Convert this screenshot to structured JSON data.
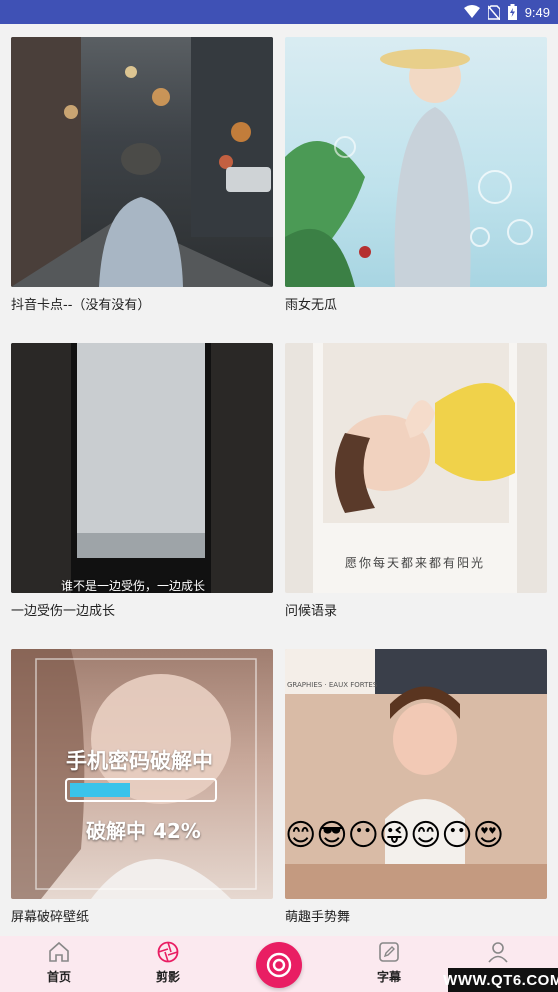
{
  "status_bar": {
    "time": "9:49"
  },
  "cards": [
    {
      "title": "抖音卡点--（没有没有）"
    },
    {
      "title": "雨女无瓜"
    },
    {
      "title": "一边受伤一边成长",
      "overlay": "谁不是一边受伤，一边成长"
    },
    {
      "title": "问候语录",
      "overlay": "愿你每天都来都有阳光"
    },
    {
      "title": "屏幕破碎壁纸",
      "overlay_top": "手机密码破解中",
      "overlay_bottom": "破解中 42%",
      "progress": 0.42
    },
    {
      "title": "萌趣手势舞",
      "overlay": "GRAPHIES · EAUX FORTES"
    }
  ],
  "nav": {
    "home": "首页",
    "clip": "剪影",
    "subtitle": "字幕",
    "mine": "我的"
  },
  "watermark": "WWW.QT6.COM",
  "colors": {
    "status_bar": "#3f51b5",
    "accent": "#e91e63",
    "nav_bg": "#fbe9ef"
  }
}
